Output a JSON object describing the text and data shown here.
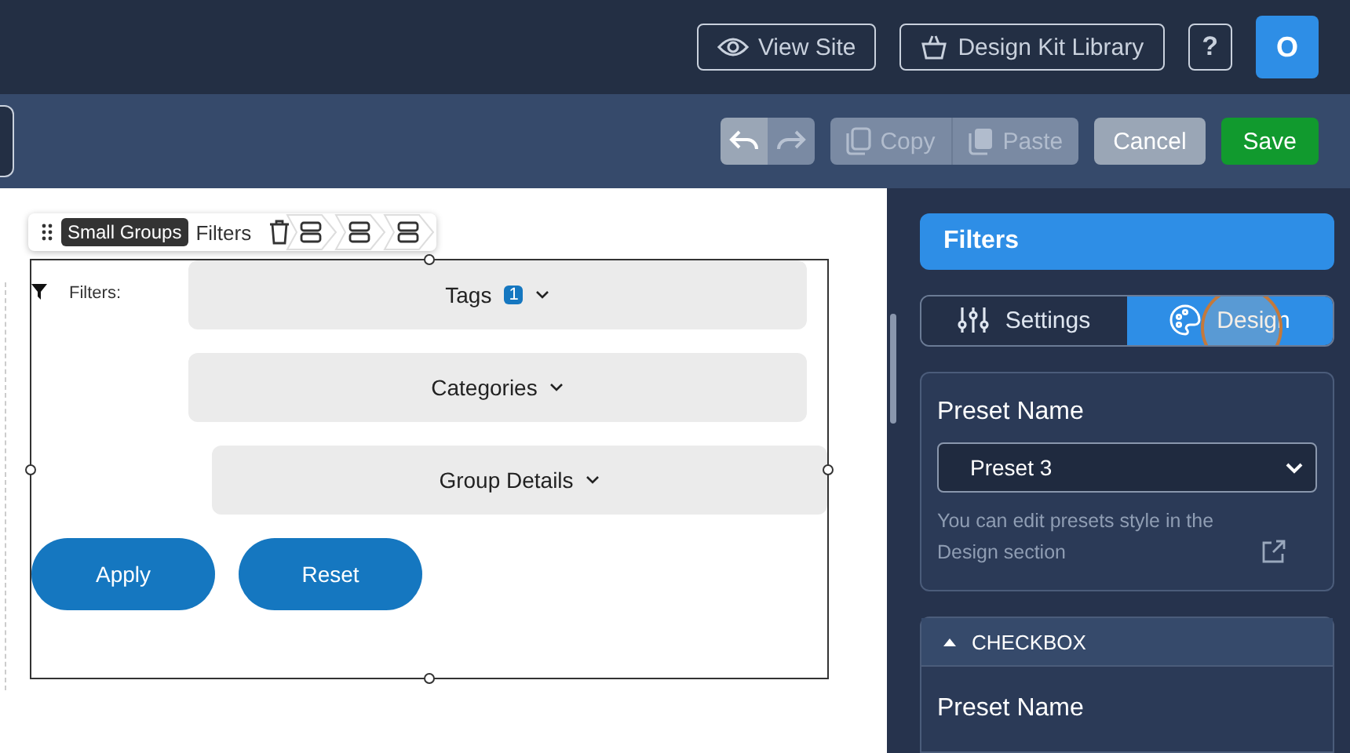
{
  "top_bar": {
    "view_site": "View Site",
    "design_kit": "Design Kit Library",
    "help": "?",
    "avatar": "O"
  },
  "toolbar": {
    "undo_disabled": false,
    "redo_disabled": true,
    "copy": {
      "label": "Copy",
      "disabled": true
    },
    "paste": {
      "label": "Paste",
      "disabled": true
    },
    "cancel": "Cancel",
    "save": "Save"
  },
  "canvas": {
    "widget_toolbar": {
      "tag": "Small Groups",
      "name": "Filters"
    },
    "filter_label": "Filters:",
    "dropdowns": [
      {
        "label": "Tags",
        "badge": "1"
      },
      {
        "label": "Categories"
      },
      {
        "label": "Group Details"
      }
    ],
    "buttons": [
      "Apply",
      "Reset"
    ]
  },
  "panel": {
    "title": "Filters",
    "tabs": [
      {
        "label": "Settings",
        "kind": "settings",
        "selected": false
      },
      {
        "label": "Design",
        "kind": "design",
        "selected": true
      }
    ],
    "preset": {
      "label": "Preset Name",
      "value": "Preset 3",
      "hint": "You can edit presets style in the Design section"
    },
    "accordion": {
      "title": "CHECKBOX",
      "expanded": true,
      "label": "Preset Name"
    }
  }
}
